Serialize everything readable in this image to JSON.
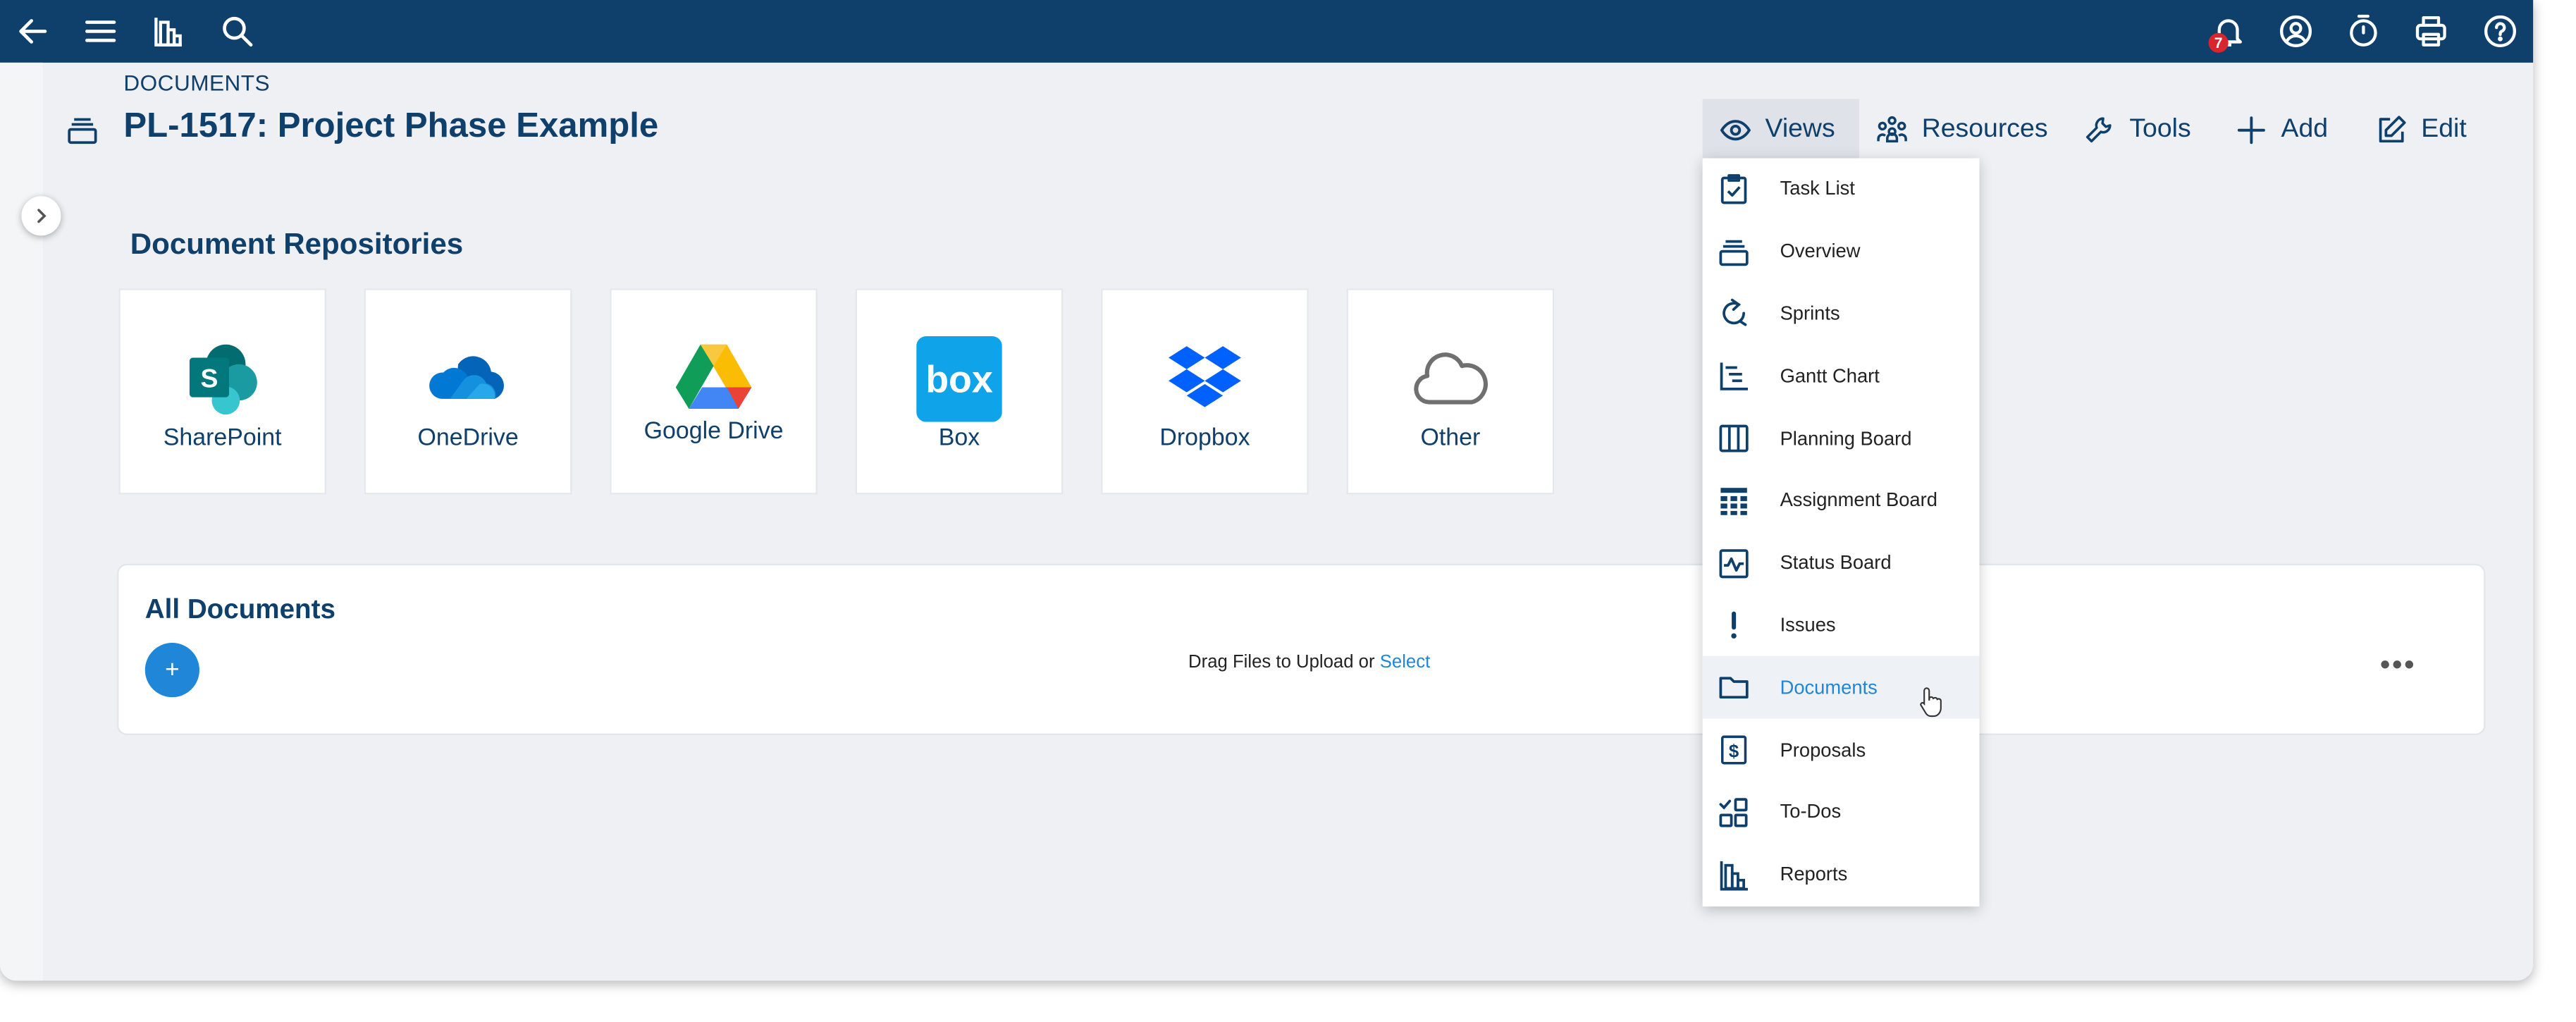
{
  "topbar": {
    "icons": [
      "back-arrow-icon",
      "hamburger-menu-icon",
      "reports-chart-icon",
      "search-icon",
      "bell-icon",
      "user-circle-icon",
      "stopwatch-icon",
      "printer-icon",
      "help-icon"
    ],
    "notification_count": "7",
    "bar_color": "#0f3f6b",
    "badge_color": "#d7262e"
  },
  "header": {
    "breadcrumb": "DOCUMENTS",
    "title": "PL-1517: Project Phase Example"
  },
  "actions": {
    "views": "Views",
    "resources": "Resources",
    "tools": "Tools",
    "add": "Add",
    "edit": "Edit"
  },
  "repositories": {
    "title": "Document Repositories",
    "items": [
      {
        "label": "SharePoint",
        "icon": "sharepoint-logo"
      },
      {
        "label": "OneDrive",
        "icon": "onedrive-logo"
      },
      {
        "label": "Google Drive",
        "icon": "google-drive-logo"
      },
      {
        "label": "Box",
        "icon": "box-logo"
      },
      {
        "label": "Dropbox",
        "icon": "dropbox-logo"
      },
      {
        "label": "Other",
        "icon": "cloud-icon"
      }
    ]
  },
  "all_documents": {
    "title": "All Documents",
    "add_label": "+",
    "drag_text": "Drag Files to Upload or",
    "select_label": "Select",
    "more_label": "•••"
  },
  "views_menu": {
    "active": "Documents",
    "accent": "#1f86d8",
    "items": [
      {
        "label": "Task List",
        "icon": "task-list-icon"
      },
      {
        "label": "Overview",
        "icon": "overview-icon"
      },
      {
        "label": "Sprints",
        "icon": "sprints-icon"
      },
      {
        "label": "Gantt Chart",
        "icon": "gantt-chart-icon"
      },
      {
        "label": "Planning Board",
        "icon": "planning-board-icon"
      },
      {
        "label": "Assignment Board",
        "icon": "assignment-board-icon"
      },
      {
        "label": "Status Board",
        "icon": "status-board-icon"
      },
      {
        "label": "Issues",
        "icon": "issues-icon"
      },
      {
        "label": "Documents",
        "icon": "folder-icon"
      },
      {
        "label": "Proposals",
        "icon": "proposals-icon"
      },
      {
        "label": "To-Dos",
        "icon": "todos-icon"
      },
      {
        "label": "Reports",
        "icon": "reports-icon"
      }
    ]
  }
}
